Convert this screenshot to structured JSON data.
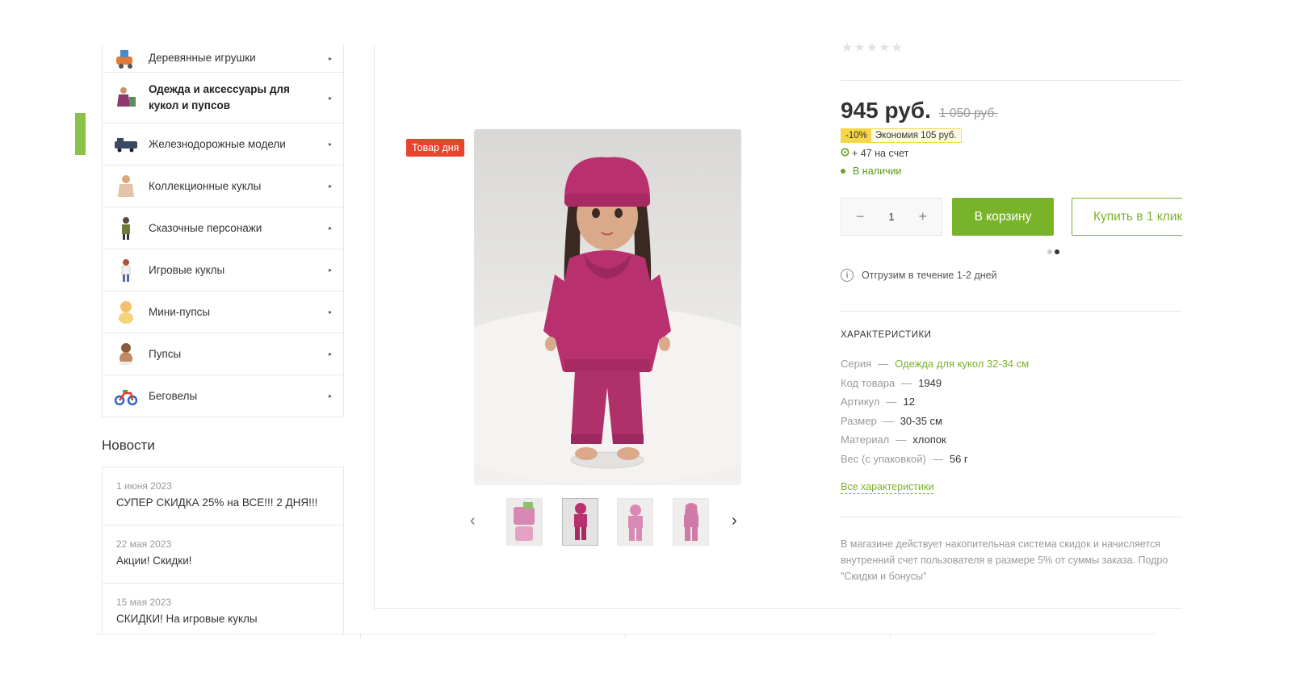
{
  "sidebar": {
    "categories": [
      {
        "label": "Деревянные игрушки"
      },
      {
        "label": "Одежда и аксессуары для кукол и пупсов"
      },
      {
        "label": "Железнодорожные модели"
      },
      {
        "label": "Коллекционные куклы"
      },
      {
        "label": "Сказочные персонажи"
      },
      {
        "label": "Игровые куклы"
      },
      {
        "label": "Мини-пупсы"
      },
      {
        "label": "Пупсы"
      },
      {
        "label": "Беговелы"
      }
    ],
    "arrow_glyph": "▸"
  },
  "news": {
    "title": "Новости",
    "items": [
      {
        "date": "1 июня 2023",
        "text": "СУПЕР СКИДКА 25% на ВСЕ!!! 2 ДНЯ!!!"
      },
      {
        "date": "22 мая 2023",
        "text": "Акции! Скидки!"
      },
      {
        "date": "15 мая 2023",
        "text": "СКИДКИ! На игровые куклы"
      }
    ]
  },
  "product": {
    "badge": "Товар дня",
    "rating_stars": "★★★★★",
    "price": "945 руб.",
    "old_price": "1 050 руб.",
    "discount_percent": "-10%",
    "discount_saving": "Экономия 105 руб.",
    "bonus": "+ 47 на счет",
    "stock": "В наличии",
    "quantity": "1",
    "qty_minus": "−",
    "qty_plus": "+",
    "cart_button": "В корзину",
    "one_click_button": "Купить в 1 клик",
    "shipping": "Отгрузим в течение 1-2 дней",
    "characteristics_title": "ХАРАКТЕРИСТИКИ",
    "characteristics": [
      {
        "key": "Серия",
        "value": "Одежда для кукол 32-34 см"
      },
      {
        "key": "Код товара",
        "value": "1949"
      },
      {
        "key": "Артикул",
        "value": "12"
      },
      {
        "key": "Размер",
        "value": "30-35 см"
      },
      {
        "key": "Материал",
        "value": "хлопок"
      },
      {
        "key": "Вес (с упаковкой)",
        "value": "56 г"
      }
    ],
    "characteristics_sep": "—",
    "all_characteristics": "Все характеристики",
    "footnote_lines": [
      "В магазине действует накопительная система скидок и начисляется",
      "внутренний счет пользователя в размере 5% от суммы заказа. Подро",
      "\"Скидки и бонусы\""
    ],
    "gallery_prev": "‹",
    "gallery_next": "›"
  },
  "colors": {
    "accent_green": "#79b32a",
    "badge_red": "#e8442c",
    "discount_yellow": "#f7d748",
    "doll_pink": "#b8306e"
  }
}
